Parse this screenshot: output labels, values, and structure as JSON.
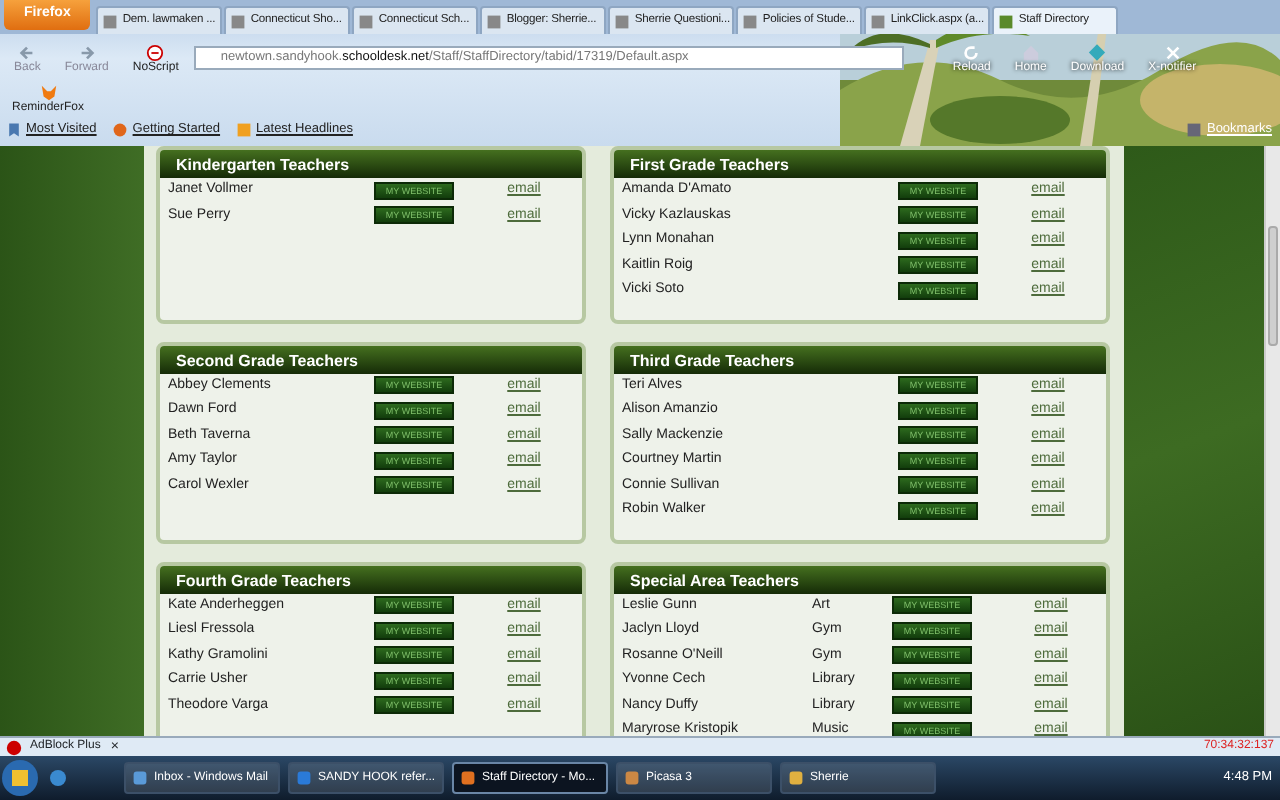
{
  "browser": {
    "menu_button": "Firefox",
    "tabs": [
      {
        "title": "Dem. lawmaken ...",
        "selected": false
      },
      {
        "title": "Connecticut Sho...",
        "selected": false
      },
      {
        "title": "Connecticut Sch...",
        "selected": false
      },
      {
        "title": "Blogger: Sherrie...",
        "selected": false
      },
      {
        "title": "Sherrie Questioni...",
        "selected": false
      },
      {
        "title": "Policies of Stude...",
        "selected": false
      },
      {
        "title": "LinkClick.aspx (a...",
        "selected": false
      },
      {
        "title": "Staff Directory",
        "selected": true
      }
    ],
    "nav_buttons": [
      {
        "label": "Back",
        "disabled": true
      },
      {
        "label": "Forward",
        "disabled": true
      },
      {
        "label": "NoScript",
        "disabled": false
      }
    ],
    "url": "newtown.sandyhook.**schooldesk.net**/Staff/StaffDirectory/tabid/17319/Default.aspx",
    "right_buttons": [
      "Reload",
      "Home",
      "Download",
      "X-notifier"
    ],
    "addon": "ReminderFox",
    "bookmarks": [
      "Most Visited",
      "Getting Started",
      "Latest Headlines"
    ],
    "bookmarks_menu": "Bookmarks"
  },
  "columns": [
    {
      "sections": [
        {
          "title": "Kindergarten Teachers",
          "rows": [
            {
              "name": "Janet Vollmer",
              "website": "MY WEBSITE",
              "email": "email"
            },
            {
              "name": "Sue Perry",
              "website": "MY WEBSITE",
              "email": "email"
            }
          ]
        },
        {
          "title": "Second Grade Teachers",
          "rows": [
            {
              "name": "Abbey Clements",
              "website": "MY WEBSITE",
              "email": "email"
            },
            {
              "name": "Dawn Ford",
              "website": "MY WEBSITE",
              "email": "email"
            },
            {
              "name": "Beth Taverna",
              "website": "MY WEBSITE",
              "email": "email"
            },
            {
              "name": "Amy Taylor",
              "website": "MY WEBSITE",
              "email": "email"
            },
            {
              "name": "Carol Wexler",
              "website": "MY WEBSITE",
              "email": "email"
            }
          ]
        },
        {
          "title": "Fourth Grade Teachers",
          "rows": [
            {
              "name": "Kate Anderheggen",
              "website": "MY WEBSITE",
              "email": "email"
            },
            {
              "name": "Liesl Fressola",
              "website": "MY WEBSITE",
              "email": "email"
            },
            {
              "name": "Kathy Gramolini",
              "website": "MY WEBSITE",
              "email": "email"
            },
            {
              "name": "Carrie Usher",
              "website": "MY WEBSITE",
              "email": "email"
            },
            {
              "name": "Theodore Varga",
              "website": "MY WEBSITE",
              "email": "email"
            }
          ]
        }
      ]
    },
    {
      "sections": [
        {
          "title": "First Grade Teachers",
          "rows": [
            {
              "name": "Amanda D'Amato",
              "website": "MY WEBSITE",
              "email": "email"
            },
            {
              "name": "Vicky Kazlauskas",
              "website": "MY WEBSITE",
              "email": "email"
            },
            {
              "name": "Lynn Monahan",
              "website": "MY WEBSITE",
              "email": "email"
            },
            {
              "name": "Kaitlin Roig",
              "website": "MY WEBSITE",
              "email": "email"
            },
            {
              "name": "Vicki Soto",
              "website": "MY WEBSITE",
              "email": "email"
            }
          ]
        },
        {
          "title": "Third Grade Teachers",
          "rows": [
            {
              "name": "Teri Alves",
              "website": "MY WEBSITE",
              "email": "email"
            },
            {
              "name": "Alison Amanzio",
              "website": "MY WEBSITE",
              "email": "email"
            },
            {
              "name": "Sally Mackenzie",
              "website": "MY WEBSITE",
              "email": "email"
            },
            {
              "name": "Courtney Martin",
              "website": "MY WEBSITE",
              "email": "email"
            },
            {
              "name": "Connie Sullivan",
              "website": "MY WEBSITE",
              "email": "email"
            },
            {
              "name": "Robin Walker",
              "website": "MY WEBSITE",
              "email": "email"
            }
          ]
        },
        {
          "title": "Special Area Teachers",
          "rows": [
            {
              "name": "Leslie Gunn",
              "subject": "Art",
              "website": "MY WEBSITE",
              "email": "email"
            },
            {
              "name": "Jaclyn Lloyd",
              "subject": "Gym",
              "website": "MY WEBSITE",
              "email": "email"
            },
            {
              "name": "Rosanne O'Neill",
              "subject": "Gym",
              "website": "MY WEBSITE",
              "email": "email"
            },
            {
              "name": "Yvonne Cech",
              "subject": "Library",
              "website": "MY WEBSITE",
              "email": "email"
            },
            {
              "name": "Nancy Duffy",
              "subject": "Library",
              "website": "MY WEBSITE",
              "email": "email"
            },
            {
              "name": "Maryrose Kristopik",
              "subject": "Music",
              "website": "MY WEBSITE",
              "email": "email"
            }
          ]
        }
      ]
    }
  ],
  "addon_bar": {
    "name": "AdBlock Plus",
    "close": "×",
    "counter": "70:34:32:137"
  },
  "taskbar": {
    "tasks": [
      {
        "title": "Inbox - Windows Mail",
        "selected": false
      },
      {
        "title": "SANDY HOOK refer...",
        "selected": false
      },
      {
        "title": "Staff Directory - Mo...",
        "selected": true
      },
      {
        "title": "Picasa 3",
        "selected": false
      },
      {
        "title": "Sherrie",
        "selected": false
      }
    ],
    "clock": "4:48 PM"
  }
}
